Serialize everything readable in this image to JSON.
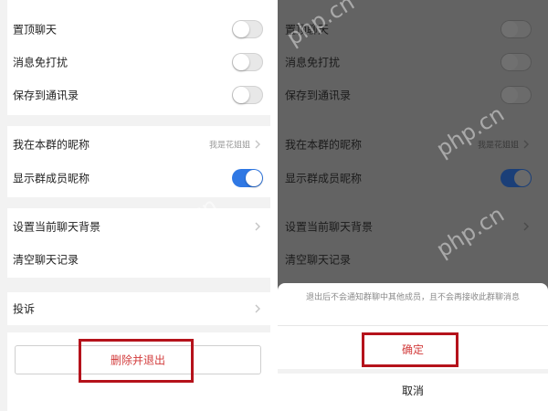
{
  "left": {
    "pin_chat": "置顶聊天",
    "mute": "消息免打扰",
    "save_contacts": "保存到通讯录",
    "nickname_label": "我在本群的昵称",
    "nickname_value": "我是花姐姐",
    "show_nicknames": "显示群成员昵称",
    "set_background": "设置当前聊天背景",
    "clear_history": "清空聊天记录",
    "report": "投诉",
    "delete_exit": "删除并退出"
  },
  "right": {
    "pin_chat": "置顶聊天",
    "mute": "消息免打扰",
    "save_contacts": "保存到通讯录",
    "nickname_label": "我在本群的昵称",
    "nickname_value": "我是花姐姐",
    "show_nicknames": "显示群成员昵称",
    "set_background": "设置当前聊天背景",
    "clear_history": "清空聊天记录",
    "sheet_message": "退出后不会通知群聊中其他成员，且不会再接收此群聊消息",
    "confirm": "确定",
    "cancel": "取消"
  },
  "watermark": "php.cn",
  "colors": {
    "toggle_on": "#2f78e4",
    "danger_text": "#d23b3b",
    "highlight_box": "#b5121b",
    "dim_overlay": "#636363"
  },
  "states": {
    "pin_chat_on": false,
    "mute_on": false,
    "save_contacts_on": false,
    "show_nicknames_on": true
  }
}
